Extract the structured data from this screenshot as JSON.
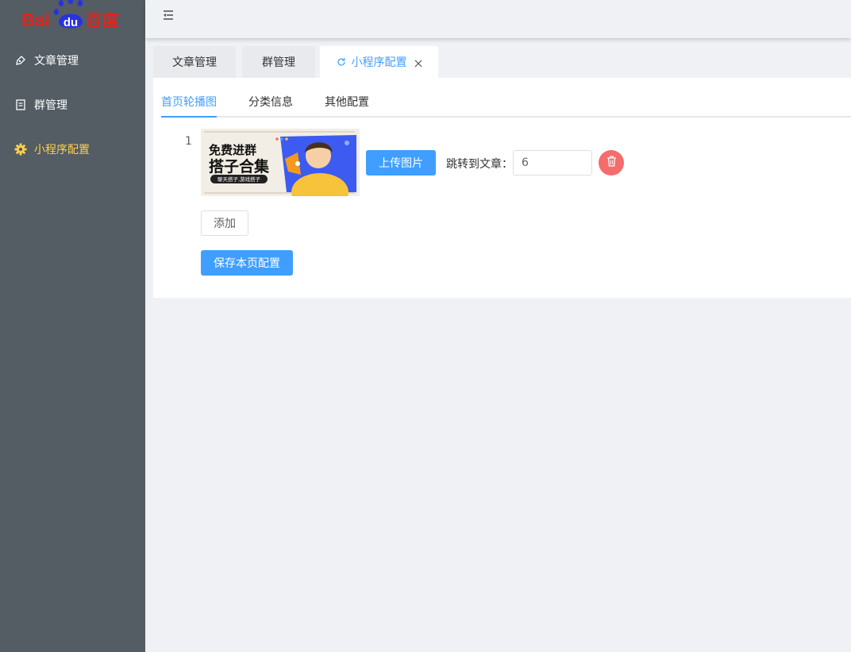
{
  "logo": {
    "left_text": "Bai",
    "paw_text": "du",
    "right_text": "百度"
  },
  "sidebar": {
    "items": [
      {
        "label": "文章管理",
        "icon": "pen-nib-icon"
      },
      {
        "label": "群管理",
        "icon": "document-icon"
      },
      {
        "label": "小程序配置",
        "icon": "gear-icon",
        "active": true
      }
    ]
  },
  "page_tabs": [
    {
      "label": "文章管理"
    },
    {
      "label": "群管理"
    },
    {
      "label": "小程序配置",
      "active": true
    }
  ],
  "sub_tabs": [
    {
      "label": "首页轮播图",
      "active": true
    },
    {
      "label": "分类信息"
    },
    {
      "label": "其他配置"
    }
  ],
  "carousel": {
    "rows": [
      {
        "index": "1",
        "image_text": {
          "line1": "免费进群",
          "line2": "搭子合集",
          "tag": "聊天搭子,游戏搭子"
        },
        "upload_label": "上传图片",
        "jump_label": "跳转到文章：",
        "jump_value": "6"
      }
    ],
    "add_label": "添加",
    "save_label": "保存本页配置"
  },
  "colors": {
    "sidebar_bg": "#545c64",
    "accent": "#409eff",
    "active_menu": "#ffd04b",
    "danger": "#f56c6c"
  }
}
